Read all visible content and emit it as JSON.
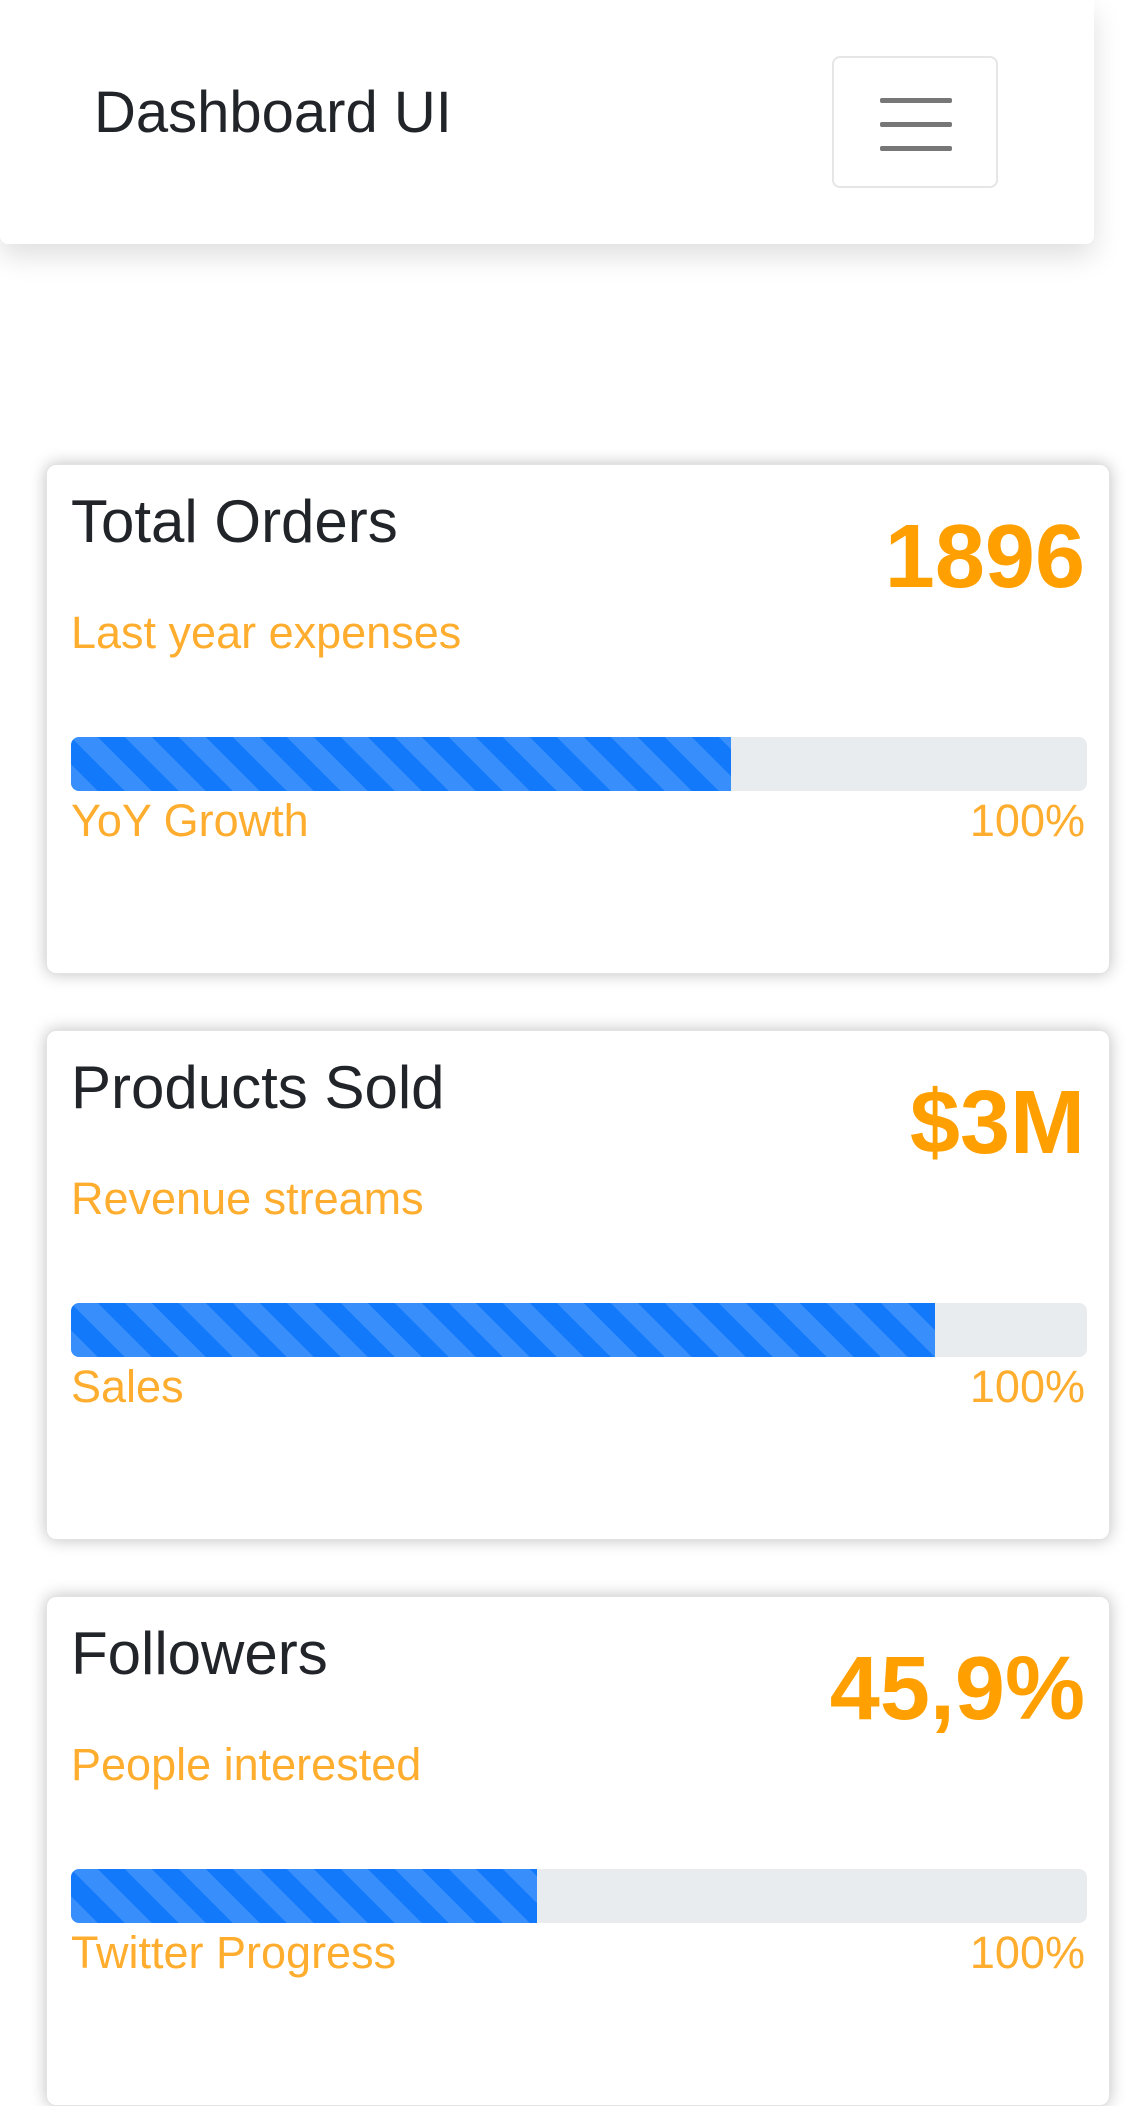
{
  "navbar": {
    "brand": "Dashboard UI",
    "toggler_icon": "hamburger-menu-icon"
  },
  "cards": [
    {
      "title": "Total Orders",
      "value": "1896",
      "subtitle": "Last year expenses",
      "progress_label": "YoY Growth",
      "progress_max_text": "100%",
      "progress_fraction": 0.65
    },
    {
      "title": "Products Sold",
      "value": "$3M",
      "subtitle": "Revenue streams",
      "progress_label": "Sales",
      "progress_max_text": "100%",
      "progress_fraction": 0.85
    },
    {
      "title": "Followers",
      "value": "45,9%",
      "subtitle": "People interested",
      "progress_label": "Twitter Progress",
      "progress_max_text": "100%",
      "progress_fraction": 0.459
    }
  ],
  "colors": {
    "accent": "#ff9f00",
    "progress_bar": "#1279fb",
    "progress_track": "#e9ecef"
  }
}
